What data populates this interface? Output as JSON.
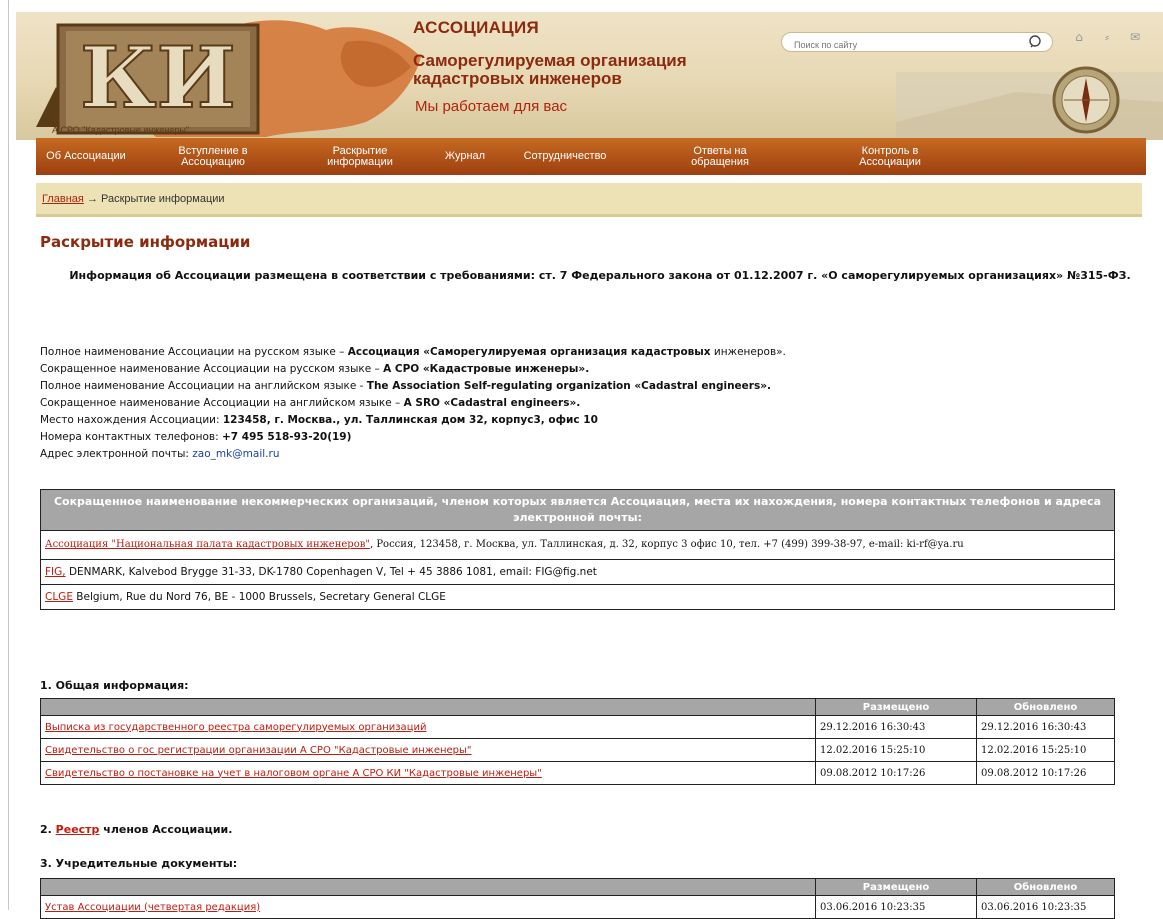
{
  "header": {
    "title": "АССОЦИАЦИЯ",
    "subtitle": "Саморегулируемая организация кадастровых инженеров",
    "slogan": "Мы работаем для вас",
    "logo_text": "КИ",
    "logo_caption": "А СРО \"Кадастровые инженеры\"",
    "search_placeholder": "Поиск по сайту",
    "icons": [
      "home-icon",
      "sitemap-icon",
      "mail-icon"
    ]
  },
  "nav": [
    "Об Ассоциации",
    "Вступление в Ассоциацию",
    "Раскрытие информации",
    "Журнал",
    "Сотрудничество",
    "Ответы на обращения",
    "Контроль в Ассоциации"
  ],
  "breadcrumb": {
    "home": "Главная",
    "sep": "→",
    "current": "Раскрытие информации"
  },
  "page_title": "Раскрытие информации",
  "intro": "Информация об Ассоциации размещена в соответствии с требованиями: ст. 7 Федерального закона от 01.12.2007 г. «О саморегулируемых организациях» №315-ФЗ.",
  "info": {
    "full_ru_label": "Полное наименование Ассоциации на русском языке – ",
    "full_ru_value": "Ассоциация «Саморегулируемая организация кадастровых",
    "full_ru_tail": " инженеров».",
    "short_ru_label": "Сокращенное наименование Ассоциации на русском языке – ",
    "short_ru_value": "А СРО «Кадастровые инженеры».",
    "full_en_label": "Полное наименование Ассоциации на английском языке - ",
    "full_en_value": "The Association Self-regulating organization «Cadastral engineers».",
    "short_en_label": "Сокращенное наименование Ассоциации на английском языке – ",
    "short_en_value": "A SRO «Cadastral engineers».",
    "address_label": "Место нахождения Ассоциации: ",
    "address_value": "123458, г. Москва., ул. Таллинская дом 32, корпус3, офис 10",
    "phone_label": "Номера контактных телефонов: ",
    "phone_value": "+7 495 518-93-20(19)",
    "email_label": "Адрес электронной почты: ",
    "email_value": "zao_mk@mail.ru"
  },
  "orgs": {
    "header": "Сокращенное наименование некоммерческих организаций, членом которых является Ассоциация, места их нахождения, номера контактных телефонов и адреса электронной почты:",
    "rows": [
      {
        "link": "Ассоциация \"Национальная палата кадастровых инженеров\"",
        "text": ", Россия, 123458, г. Москва, ул. Таллинская, д. 32, корпус 3 офис 10, тел. +7 (499) 399-38-97, e-mail: ki-rf@ya.ru"
      },
      {
        "link": "FIG,",
        "text": " DENMARK, Kalvebod Brygge 31-33, DK-1780 Copenhagen V, Tel + 45 3886 1081, email: FIG@fig.net"
      },
      {
        "link": "CLGE",
        "text": " Belgium, Rue du Nord 76, BE - 1000 Brussels, Secretary General CLGE"
      }
    ]
  },
  "section1": {
    "title": "1. Общая информация:",
    "col_placed": "Размещено",
    "col_updated": "Обновлено",
    "rows": [
      {
        "name": "Выписка из государственного реестра саморегулируемых организаций",
        "placed": "29.12.2016 16:30:43",
        "updated": "29.12.2016 16:30:43"
      },
      {
        "name": "Свидетельство о гос регистрации организации А СРО \"Кадастровые инженеры\"",
        "placed": "12.02.2016 15:25:10",
        "updated": "12.02.2016 15:25:10"
      },
      {
        "name": "Свидетельство о постановке на учет в налоговом органе А СРО КИ \"Кадастровые инженеры\"",
        "placed": "09.08.2012 10:17:26",
        "updated": "09.08.2012 10:17:26"
      }
    ]
  },
  "section2": {
    "prefix": "2. ",
    "link": "Реестр",
    "suffix": " членов Ассоциации."
  },
  "section3": {
    "title": "3. Учредительные документы:",
    "col_placed": "Размещено",
    "col_updated": "Обновлено",
    "rows": [
      {
        "name": "Устав Ассоциации (четвертая редакция)",
        "placed": "03.06.2016 10:23:35",
        "updated": "03.06.2016 10:23:35"
      }
    ]
  }
}
